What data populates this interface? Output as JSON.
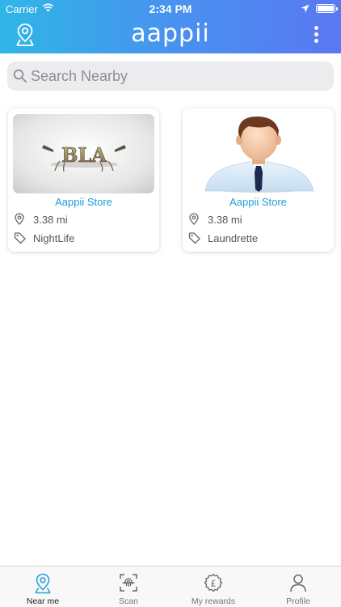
{
  "status_bar": {
    "carrier": "Carrier",
    "time": "2:34 PM"
  },
  "header": {
    "logo": "aappii"
  },
  "search": {
    "placeholder": "Search Nearby"
  },
  "stores": [
    {
      "name": "Aappii Store",
      "distance": "3.38 mi",
      "category": "NightLife",
      "image": "bla-logo"
    },
    {
      "name": "Aappii Store",
      "distance": "3.38 mi",
      "category": "Laundrette",
      "image": "person-avatar"
    }
  ],
  "tabs": [
    {
      "label": "Near me",
      "icon": "location-pin-icon",
      "active": true
    },
    {
      "label": "Scan",
      "icon": "scan-fingerprint-icon",
      "active": false
    },
    {
      "label": "My rewards",
      "icon": "pound-badge-icon",
      "active": false
    },
    {
      "label": "Profile",
      "icon": "person-icon",
      "active": false
    }
  ],
  "colors": {
    "header_start": "#2fb6e6",
    "header_end": "#5a78f2",
    "accent": "#1a9fd8"
  }
}
